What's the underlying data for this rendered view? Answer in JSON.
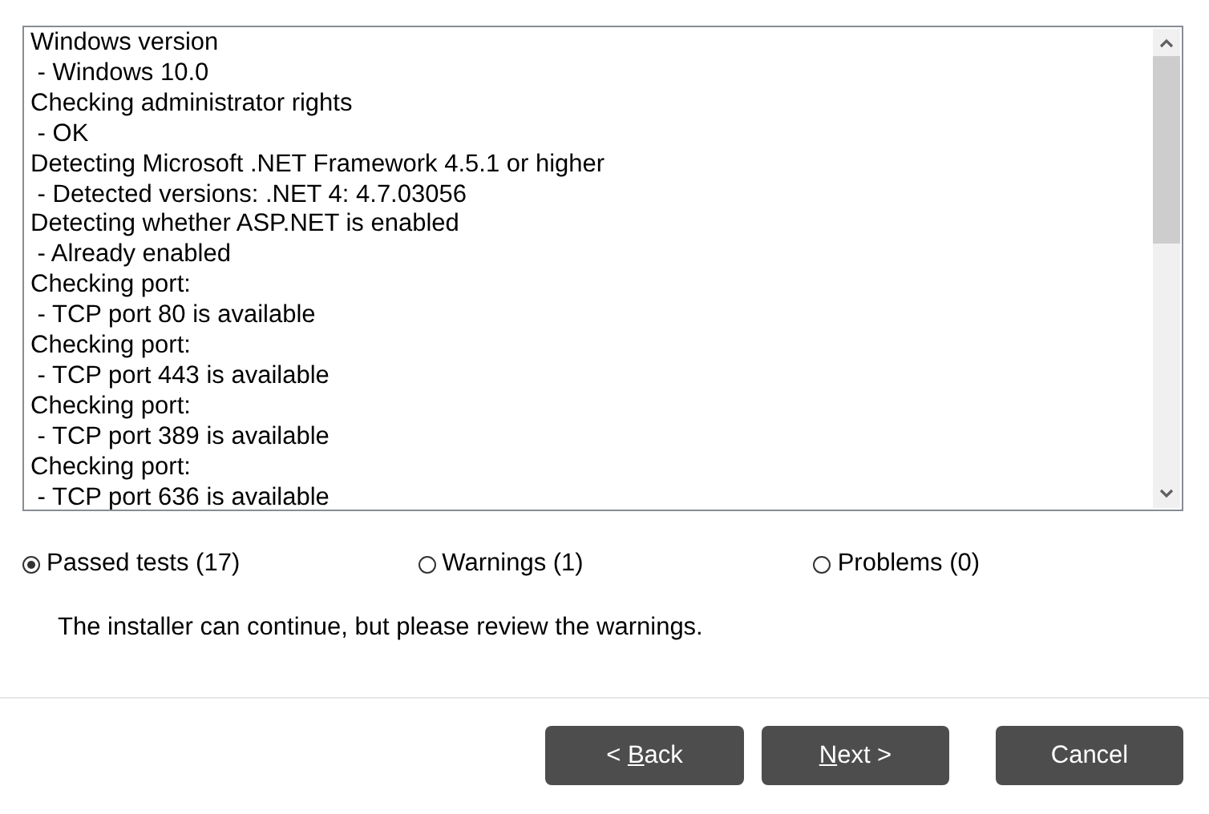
{
  "log_lines": [
    "Windows version",
    " - Windows 10.0",
    "Checking administrator rights",
    " - OK",
    "Detecting Microsoft .NET Framework 4.5.1 or higher",
    " - Detected versions: .NET 4: 4.7.03056",
    "Detecting whether ASP.NET is enabled",
    " - Already enabled",
    "Checking port:",
    " - TCP port 80 is available",
    "Checking port:",
    " - TCP port 443 is available",
    "Checking port:",
    " - TCP port 389 is available",
    "Checking port:",
    " - TCP port 636 is available"
  ],
  "filters": [
    {
      "label": "Passed tests (17)",
      "selected": true
    },
    {
      "label": "Warnings (1)",
      "selected": false
    },
    {
      "label": "Problems (0)",
      "selected": false
    }
  ],
  "message": "The installer can continue, but please review the warnings.",
  "buttons": [
    {
      "kind": "back",
      "before": "< ",
      "access_key": "B",
      "after": "ack"
    },
    {
      "kind": "next",
      "access_key": "N",
      "after": "ext >"
    },
    {
      "kind": "cancel",
      "before": "Cancel"
    }
  ]
}
